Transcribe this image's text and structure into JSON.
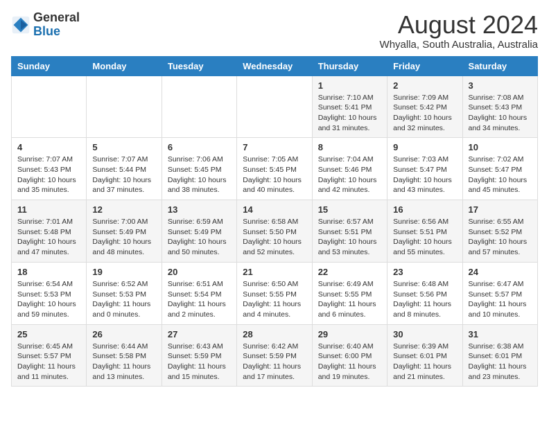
{
  "header": {
    "logo_line1": "General",
    "logo_line2": "Blue",
    "month": "August 2024",
    "location": "Whyalla, South Australia, Australia"
  },
  "weekdays": [
    "Sunday",
    "Monday",
    "Tuesday",
    "Wednesday",
    "Thursday",
    "Friday",
    "Saturday"
  ],
  "weeks": [
    [
      {
        "day": "",
        "info": ""
      },
      {
        "day": "",
        "info": ""
      },
      {
        "day": "",
        "info": ""
      },
      {
        "day": "",
        "info": ""
      },
      {
        "day": "1",
        "info": "Sunrise: 7:10 AM\nSunset: 5:41 PM\nDaylight: 10 hours\nand 31 minutes."
      },
      {
        "day": "2",
        "info": "Sunrise: 7:09 AM\nSunset: 5:42 PM\nDaylight: 10 hours\nand 32 minutes."
      },
      {
        "day": "3",
        "info": "Sunrise: 7:08 AM\nSunset: 5:43 PM\nDaylight: 10 hours\nand 34 minutes."
      }
    ],
    [
      {
        "day": "4",
        "info": "Sunrise: 7:07 AM\nSunset: 5:43 PM\nDaylight: 10 hours\nand 35 minutes."
      },
      {
        "day": "5",
        "info": "Sunrise: 7:07 AM\nSunset: 5:44 PM\nDaylight: 10 hours\nand 37 minutes."
      },
      {
        "day": "6",
        "info": "Sunrise: 7:06 AM\nSunset: 5:45 PM\nDaylight: 10 hours\nand 38 minutes."
      },
      {
        "day": "7",
        "info": "Sunrise: 7:05 AM\nSunset: 5:45 PM\nDaylight: 10 hours\nand 40 minutes."
      },
      {
        "day": "8",
        "info": "Sunrise: 7:04 AM\nSunset: 5:46 PM\nDaylight: 10 hours\nand 42 minutes."
      },
      {
        "day": "9",
        "info": "Sunrise: 7:03 AM\nSunset: 5:47 PM\nDaylight: 10 hours\nand 43 minutes."
      },
      {
        "day": "10",
        "info": "Sunrise: 7:02 AM\nSunset: 5:47 PM\nDaylight: 10 hours\nand 45 minutes."
      }
    ],
    [
      {
        "day": "11",
        "info": "Sunrise: 7:01 AM\nSunset: 5:48 PM\nDaylight: 10 hours\nand 47 minutes."
      },
      {
        "day": "12",
        "info": "Sunrise: 7:00 AM\nSunset: 5:49 PM\nDaylight: 10 hours\nand 48 minutes."
      },
      {
        "day": "13",
        "info": "Sunrise: 6:59 AM\nSunset: 5:49 PM\nDaylight: 10 hours\nand 50 minutes."
      },
      {
        "day": "14",
        "info": "Sunrise: 6:58 AM\nSunset: 5:50 PM\nDaylight: 10 hours\nand 52 minutes."
      },
      {
        "day": "15",
        "info": "Sunrise: 6:57 AM\nSunset: 5:51 PM\nDaylight: 10 hours\nand 53 minutes."
      },
      {
        "day": "16",
        "info": "Sunrise: 6:56 AM\nSunset: 5:51 PM\nDaylight: 10 hours\nand 55 minutes."
      },
      {
        "day": "17",
        "info": "Sunrise: 6:55 AM\nSunset: 5:52 PM\nDaylight: 10 hours\nand 57 minutes."
      }
    ],
    [
      {
        "day": "18",
        "info": "Sunrise: 6:54 AM\nSunset: 5:53 PM\nDaylight: 10 hours\nand 59 minutes."
      },
      {
        "day": "19",
        "info": "Sunrise: 6:52 AM\nSunset: 5:53 PM\nDaylight: 11 hours\nand 0 minutes."
      },
      {
        "day": "20",
        "info": "Sunrise: 6:51 AM\nSunset: 5:54 PM\nDaylight: 11 hours\nand 2 minutes."
      },
      {
        "day": "21",
        "info": "Sunrise: 6:50 AM\nSunset: 5:55 PM\nDaylight: 11 hours\nand 4 minutes."
      },
      {
        "day": "22",
        "info": "Sunrise: 6:49 AM\nSunset: 5:55 PM\nDaylight: 11 hours\nand 6 minutes."
      },
      {
        "day": "23",
        "info": "Sunrise: 6:48 AM\nSunset: 5:56 PM\nDaylight: 11 hours\nand 8 minutes."
      },
      {
        "day": "24",
        "info": "Sunrise: 6:47 AM\nSunset: 5:57 PM\nDaylight: 11 hours\nand 10 minutes."
      }
    ],
    [
      {
        "day": "25",
        "info": "Sunrise: 6:45 AM\nSunset: 5:57 PM\nDaylight: 11 hours\nand 11 minutes."
      },
      {
        "day": "26",
        "info": "Sunrise: 6:44 AM\nSunset: 5:58 PM\nDaylight: 11 hours\nand 13 minutes."
      },
      {
        "day": "27",
        "info": "Sunrise: 6:43 AM\nSunset: 5:59 PM\nDaylight: 11 hours\nand 15 minutes."
      },
      {
        "day": "28",
        "info": "Sunrise: 6:42 AM\nSunset: 5:59 PM\nDaylight: 11 hours\nand 17 minutes."
      },
      {
        "day": "29",
        "info": "Sunrise: 6:40 AM\nSunset: 6:00 PM\nDaylight: 11 hours\nand 19 minutes."
      },
      {
        "day": "30",
        "info": "Sunrise: 6:39 AM\nSunset: 6:01 PM\nDaylight: 11 hours\nand 21 minutes."
      },
      {
        "day": "31",
        "info": "Sunrise: 6:38 AM\nSunset: 6:01 PM\nDaylight: 11 hours\nand 23 minutes."
      }
    ]
  ]
}
